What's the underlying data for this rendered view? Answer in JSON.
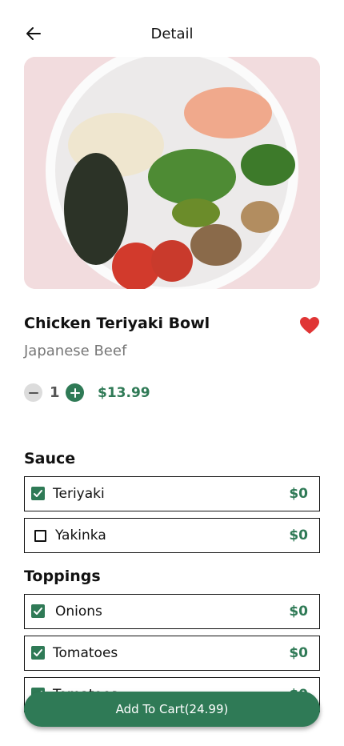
{
  "header": {
    "title": "Detail",
    "back_icon": "arrow-left-icon"
  },
  "item": {
    "name": "Chicken Teriyaki Bowl",
    "subtitle": "Japanese Beef",
    "quantity": "1",
    "price": "$13.99",
    "favorite": true
  },
  "sauce": {
    "title": "Sauce",
    "options": [
      {
        "label": "Teriyaki",
        "price": "$0",
        "checked": true
      },
      {
        "label": "Yakinka",
        "price": "$0",
        "checked": false
      }
    ]
  },
  "toppings": {
    "title": "Toppings",
    "options": [
      {
        "label": "Onions",
        "price": "$0",
        "checked": true
      },
      {
        "label": "Tomatoes",
        "price": "$0",
        "checked": true
      },
      {
        "label": "Tomatoes",
        "price": "$0",
        "checked": true
      }
    ]
  },
  "cart": {
    "label": "Add To Cart(24.99)"
  },
  "colors": {
    "accent": "#2f7a56",
    "heart": "#e03535",
    "image_bg": "#f2dcde"
  }
}
